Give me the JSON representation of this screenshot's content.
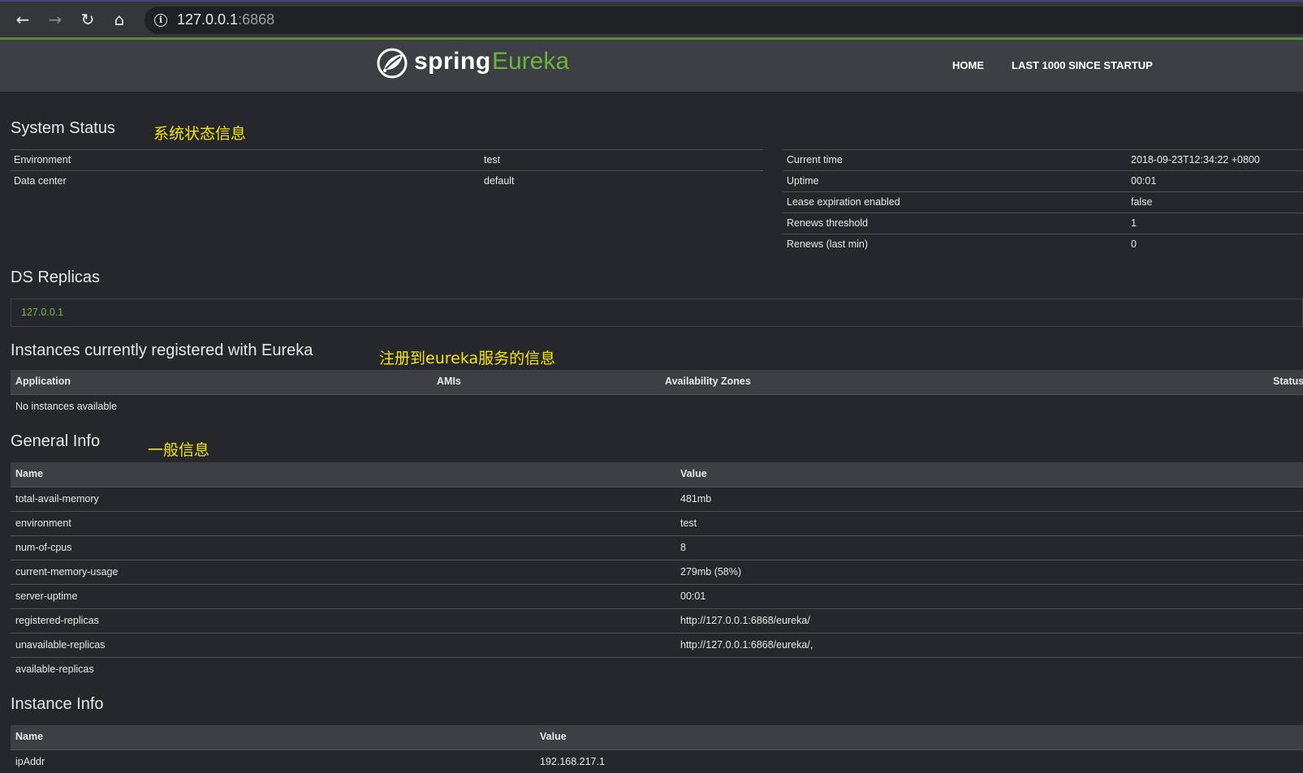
{
  "browser": {
    "url_host": "127.0.0.1",
    "url_port": ":6868"
  },
  "header": {
    "logo_spring": "spring",
    "logo_eureka": "Eureka",
    "nav": [
      "HOME",
      "LAST 1000 SINCE STARTUP"
    ]
  },
  "system_status": {
    "title": "System Status",
    "annotation": "系统状态信息",
    "left": [
      {
        "label": "Environment",
        "value": "test"
      },
      {
        "label": "Data center",
        "value": "default"
      }
    ],
    "right": [
      {
        "label": "Current time",
        "value": "2018-09-23T12:34:22 +0800"
      },
      {
        "label": "Uptime",
        "value": "00:01"
      },
      {
        "label": "Lease expiration enabled",
        "value": "false"
      },
      {
        "label": "Renews threshold",
        "value": "1"
      },
      {
        "label": "Renews (last min)",
        "value": "0"
      }
    ]
  },
  "ds_replicas": {
    "title": "DS Replicas",
    "items": [
      "127.0.0.1"
    ]
  },
  "instances": {
    "title": "Instances currently registered with Eureka",
    "annotation": "注册到eureka服务的信息",
    "columns": [
      "Application",
      "AMIs",
      "Availability Zones",
      "Status"
    ],
    "empty_text": "No instances available"
  },
  "general_info": {
    "title": "General Info",
    "annotation": "一般信息",
    "columns": [
      "Name",
      "Value"
    ],
    "rows": [
      {
        "name": "total-avail-memory",
        "value": "481mb"
      },
      {
        "name": "environment",
        "value": "test"
      },
      {
        "name": "num-of-cpus",
        "value": "8"
      },
      {
        "name": "current-memory-usage",
        "value": "279mb (58%)"
      },
      {
        "name": "server-uptime",
        "value": "00:01"
      },
      {
        "name": "registered-replicas",
        "value": "http://127.0.0.1:6868/eureka/"
      },
      {
        "name": "unavailable-replicas",
        "value": "http://127.0.0.1:6868/eureka/,"
      },
      {
        "name": "available-replicas",
        "value": ""
      }
    ]
  },
  "instance_info": {
    "title": "Instance Info",
    "columns": [
      "Name",
      "Value"
    ],
    "rows": [
      {
        "name": "ipAddr",
        "value": "192.168.217.1"
      }
    ]
  }
}
